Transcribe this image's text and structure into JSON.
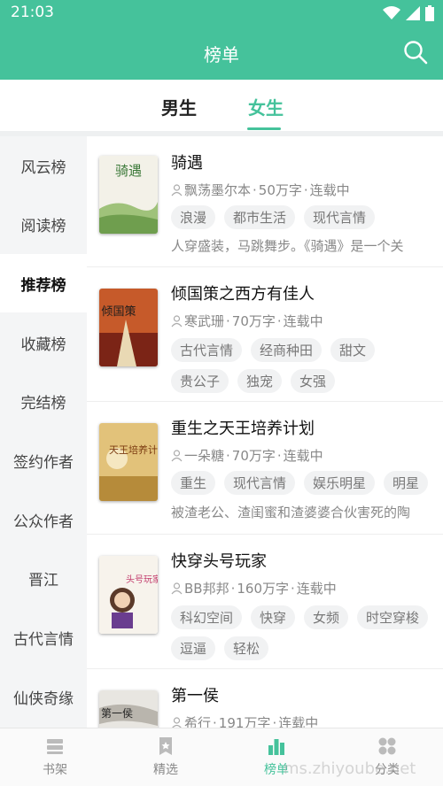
{
  "statusbar": {
    "time": "21:03"
  },
  "header": {
    "title": "榜单"
  },
  "tabs": [
    {
      "label": "男生"
    },
    {
      "label": "女生"
    }
  ],
  "sidebar": {
    "items": [
      {
        "label": "风云榜"
      },
      {
        "label": "阅读榜"
      },
      {
        "label": "推荐榜"
      },
      {
        "label": "收藏榜"
      },
      {
        "label": "完结榜"
      },
      {
        "label": "签约作者"
      },
      {
        "label": "公众作者"
      },
      {
        "label": "晋江"
      },
      {
        "label": "古代言情"
      },
      {
        "label": "仙侠奇缘"
      }
    ]
  },
  "books": [
    {
      "title": "骑遇",
      "author": "飘荡墨尔本",
      "words": "50万字",
      "status": "连载中",
      "tags": [
        "浪漫",
        "都市生活",
        "现代言情"
      ],
      "desc": "人穿盛装，马跳舞步。《骑遇》是一个关",
      "cover_text": "骑遇"
    },
    {
      "title": "倾国策之西方有佳人",
      "author": "寒武珊",
      "words": "70万字",
      "status": "连载中",
      "tags": [
        "古代言情",
        "经商种田",
        "甜文",
        "贵公子",
        "独宠",
        "女强"
      ],
      "desc": "",
      "cover_text": "倾国策"
    },
    {
      "title": "重生之天王培养计划",
      "author": "一朵糖",
      "words": "70万字",
      "status": "连载中",
      "tags": [
        "重生",
        "现代言情",
        "娱乐明星",
        "明星"
      ],
      "desc": "被渣老公、渣闺蜜和渣婆婆合伙害死的陶",
      "cover_text": "天王培养计划"
    },
    {
      "title": "快穿头号玩家",
      "author": "BB邦邦",
      "words": "160万字",
      "status": "连载中",
      "tags": [
        "科幻空间",
        "快穿",
        "女频",
        "时空穿梭",
        "逗逼",
        "轻松"
      ],
      "desc": "",
      "cover_text": "头号玩家"
    },
    {
      "title": "第一侯",
      "author": "希行",
      "words": "191万字",
      "status": "连载中",
      "tags": [],
      "desc": "",
      "cover_text": "第一侯"
    }
  ],
  "bottom_nav": [
    {
      "label": "书架",
      "icon": "bookshelf-icon"
    },
    {
      "label": "精选",
      "icon": "featured-icon"
    },
    {
      "label": "榜单",
      "icon": "ranking-icon"
    },
    {
      "label": "分类",
      "icon": "category-icon"
    }
  ],
  "watermark": "ms.zhiyoube.net",
  "colors": {
    "accent": "#45c29b",
    "sidebar_bg": "#f4f5f6",
    "tag_bg": "#f1f2f3"
  }
}
